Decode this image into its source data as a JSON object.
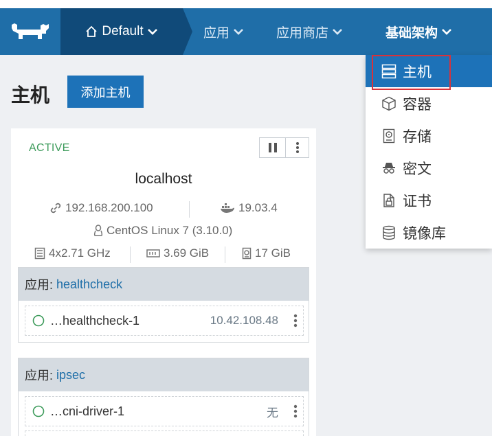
{
  "header": {
    "environment": "Default",
    "nav": [
      "应用",
      "应用商店",
      "基础架构"
    ]
  },
  "page": {
    "title": "主机",
    "add_button": "添加主机"
  },
  "host": {
    "status": "ACTIVE",
    "name": "localhost",
    "ip": "192.168.200.100",
    "docker_version": "19.03.4",
    "os": "CentOS Linux 7 (3.10.0)",
    "cpu": "4x2.71 GHz",
    "memory": "3.69 GiB",
    "disk": "17 GiB"
  },
  "stacks": [
    {
      "prefix": "应用:",
      "name": "healthcheck",
      "containers": [
        {
          "name": "…healthcheck-1",
          "ip": "10.42.108.48"
        }
      ]
    },
    {
      "prefix": "应用:",
      "name": "ipsec",
      "containers": [
        {
          "name": "…cni-driver-1",
          "ip": "无"
        }
      ]
    }
  ],
  "dropdown": {
    "items": [
      "主机",
      "容器",
      "存储",
      "密文",
      "证书",
      "镜像库"
    ],
    "active_index": 0
  },
  "colors": {
    "header_bg": "#1f6ea8",
    "env_bg": "#104a79",
    "accent": "#1d72b8",
    "active_status": "#3d9b5b",
    "highlight_box": "#d9323a"
  }
}
